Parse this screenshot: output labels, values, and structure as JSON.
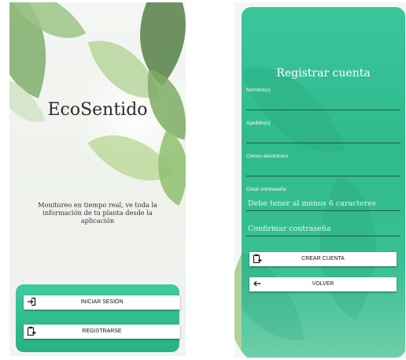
{
  "welcome_screen": {
    "app_title": "EcoSentido",
    "tagline": "Monitoreo en tiempo real, ve toda la información de tu planta desde la aplicación",
    "buttons": {
      "login": {
        "label": "INICIAR SESIÓN",
        "icon": "login-icon"
      },
      "register": {
        "label": "REGISTRARSE",
        "icon": "clipboard-icon"
      }
    }
  },
  "register_screen": {
    "title": "Registrar cuenta",
    "fields": {
      "first_name": {
        "label": "Nombre(s)",
        "value": ""
      },
      "last_name": {
        "label": "Apellido(s)",
        "value": ""
      },
      "email": {
        "label": "Correo electrónico",
        "value": ""
      },
      "password": {
        "label": "Crear contraseña",
        "placeholder": "Debe tener al menos 6 caracteres"
      },
      "confirm_password": {
        "placeholder": "Confirmar contraseña"
      }
    },
    "buttons": {
      "create": {
        "label": "CREAR CUENTA",
        "icon": "clipboard-icon"
      },
      "back": {
        "label": "VOLVER",
        "icon": "arrow-left-icon"
      }
    }
  },
  "colors": {
    "accent_green": "#2fba8d",
    "panel_green": "#3ecb9f",
    "button_bg": "#ffffff"
  }
}
